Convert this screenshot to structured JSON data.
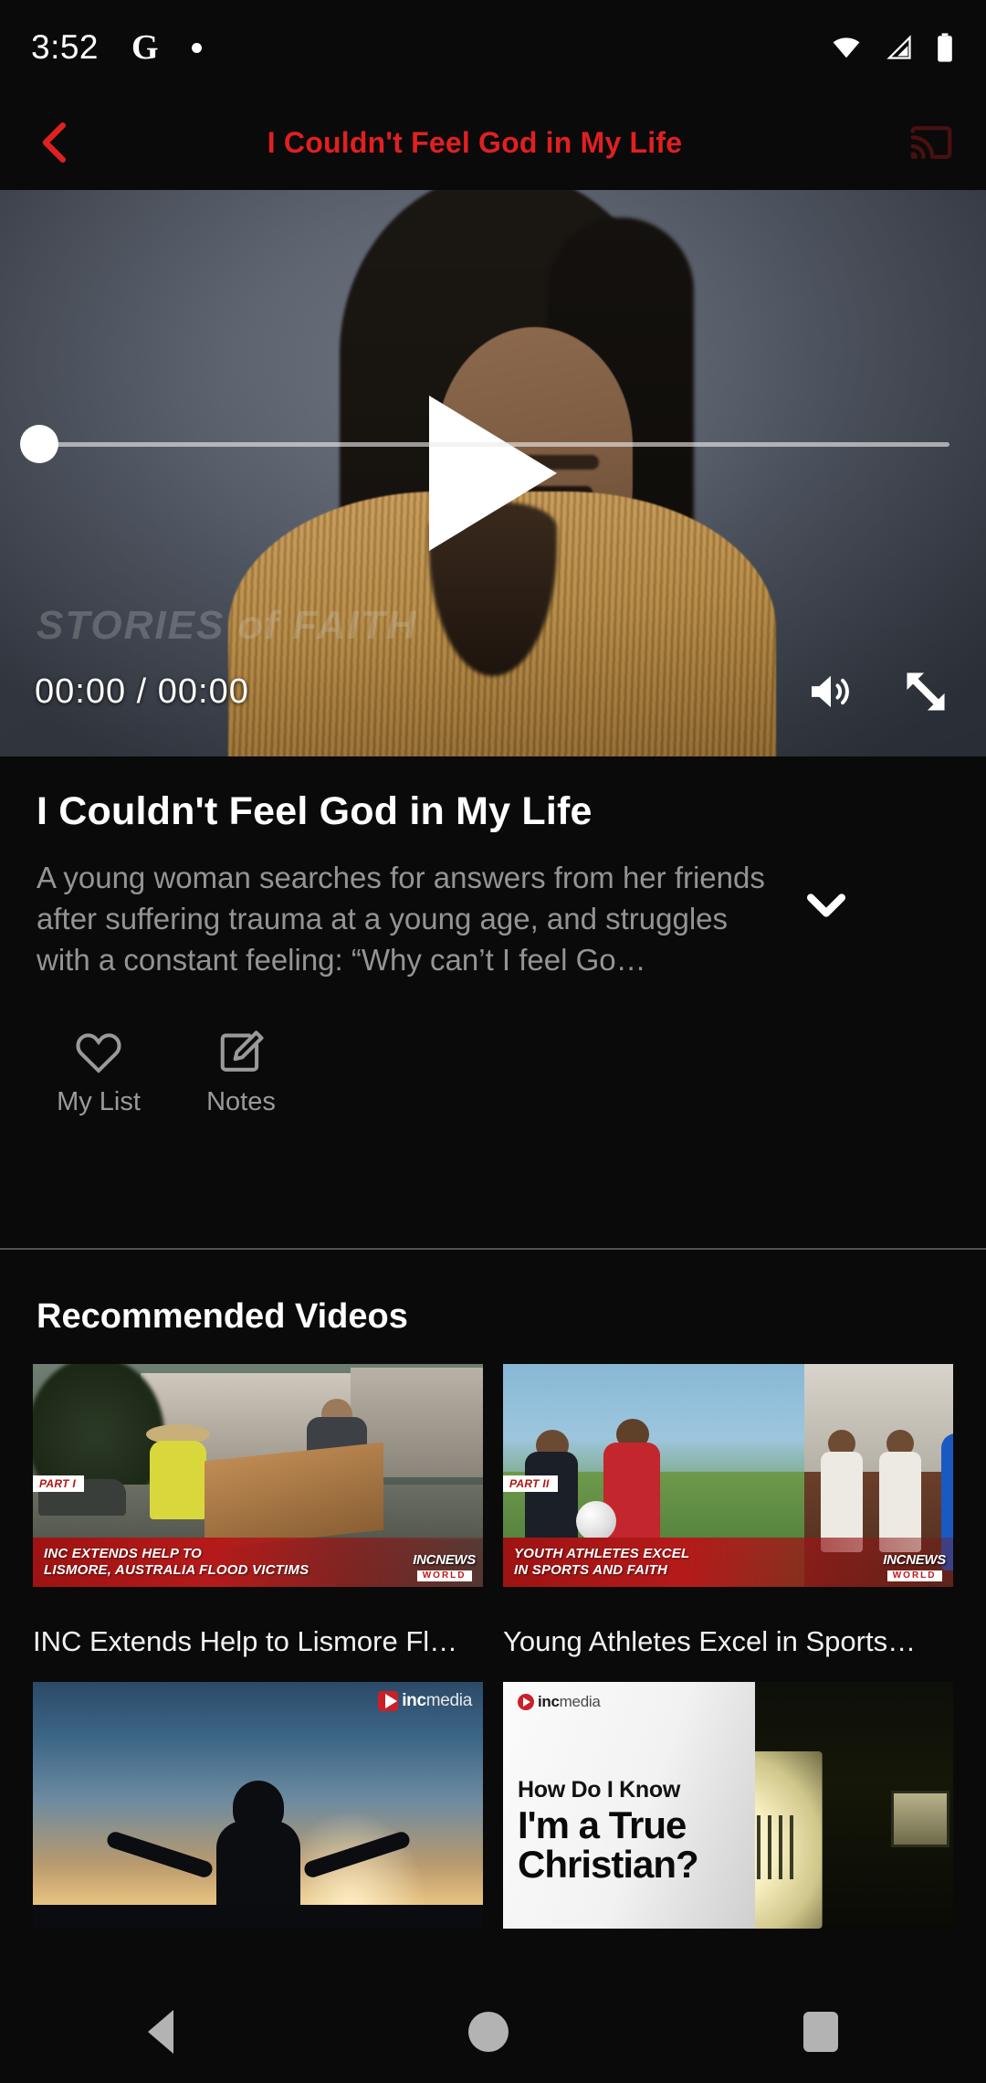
{
  "status_bar": {
    "time": "3:52",
    "google_icon": "G",
    "notification_dot": "•",
    "icons": [
      "wifi-icon",
      "cellular-signal-icon",
      "battery-icon"
    ]
  },
  "app_bar": {
    "back_icon": "back-chevron-icon",
    "title": "I Couldn't Feel God in My Life",
    "cast_icon": "cast-icon",
    "accent_color": "#e02020"
  },
  "player": {
    "play_icon": "play-icon",
    "watermark": "STORIES of FAITH",
    "current_time": "00:00",
    "separator": "/",
    "duration": "00:00",
    "time_display": "00:00 / 00:00",
    "progress_percent": 0,
    "volume_icon": "volume-on-icon",
    "fullscreen_icon": "fullscreen-expand-icon"
  },
  "info": {
    "title": "I Couldn't Feel God in My Life",
    "description": "A young woman searches for answers from her friends after suffering trauma at a young age, and struggles with a constant feeling: “Why can’t I feel Go…",
    "expand_icon": "chevron-down-icon",
    "actions": [
      {
        "icon": "heart-outline-icon",
        "label": "My List"
      },
      {
        "icon": "note-edit-icon",
        "label": "Notes"
      }
    ]
  },
  "recommended": {
    "heading": "Recommended Videos",
    "videos": [
      {
        "title": "INC Extends Help to Lismore Fl…",
        "thumb_part": "PART I",
        "thumb_headline_line1": "INC EXTENDS HELP TO",
        "thumb_headline_line2": "LISMORE, AUSTRALIA FLOOD VICTIMS",
        "thumb_logo_top": "INCNEWS",
        "thumb_logo_bottom": "WORLD"
      },
      {
        "title": "Young Athletes Excel in Sports…",
        "thumb_part": "PART II",
        "thumb_headline_line1": "YOUTH ATHLETES EXCEL",
        "thumb_headline_line2": "IN SPORTS AND FAITH",
        "thumb_logo_top": "INCNEWS",
        "thumb_logo_bottom": "WORLD"
      },
      {
        "title": "",
        "thumb_logo_bold": "inc",
        "thumb_logo_light": "media"
      },
      {
        "title": "",
        "thumb_logo_bold": "inc",
        "thumb_logo_light": "media",
        "thumb_headline_line1": "How Do I Know",
        "thumb_headline_line2": "I'm a True",
        "thumb_headline_line3": "Christian?"
      }
    ]
  },
  "nav_bar": {
    "back_icon": "nav-back-icon",
    "home_icon": "nav-home-icon",
    "recents_icon": "nav-recents-icon"
  }
}
